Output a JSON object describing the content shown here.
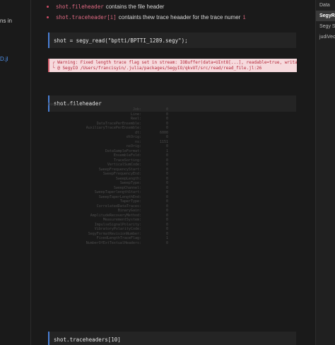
{
  "left_sidebar": {
    "fragment_1": "ns in",
    "fragment_2": "D.jl"
  },
  "bullets": [
    {
      "code": "shot.fileheader",
      "text": "contains the file header"
    },
    {
      "code": "shot.traceheader[i]",
      "text": "containts thew trace heaader for the trace numer",
      "trailing_code": "i"
    }
  ],
  "cells": {
    "read": "shot = segy_read(\"bptti/BPTTI_1289.segy\");",
    "fileheader": "shot.fileheader",
    "traceheaders": "shot.traceheaders[10]"
  },
  "warning": {
    "line1": "┌ Warning: Fixed length trace flag set in stream: IOBuffer(data=UInt8[...], readable=true, writa",
    "line2": "└ @ SegyIO /Users/francisyin/.julia/packages/SegyIO/qkvUT/src/read/read_file.jl:26"
  },
  "output": {
    "header": "BinaryFileHeader:",
    "rows": [
      {
        "k": "Job:",
        "v": "0"
      },
      {
        "k": "Line:",
        "v": "0"
      },
      {
        "k": "Reel:",
        "v": "0"
      },
      {
        "k": "DataTracePerEnsemble:",
        "v": "0"
      },
      {
        "k": "AuxiliaryTracePerEnsemble:",
        "v": "0"
      },
      {
        "k": "dt:",
        "v": "6000"
      },
      {
        "k": "dtOrig:",
        "v": "0"
      },
      {
        "k": "ns:",
        "v": "1151"
      },
      {
        "k": "nsOrig:",
        "v": "0"
      },
      {
        "k": "DataSampleFormat:",
        "v": "1"
      },
      {
        "k": "EnsembleFold:",
        "v": "0"
      },
      {
        "k": "TraceSorting:",
        "v": "0"
      },
      {
        "k": "VerticalSumCode:",
        "v": "0"
      },
      {
        "k": "SweepFrequencyStart:",
        "v": "0"
      },
      {
        "k": "SweepFrequencyEnd:",
        "v": "0"
      },
      {
        "k": "SweepLength:",
        "v": "0"
      },
      {
        "k": "SweepType:",
        "v": "0"
      },
      {
        "k": "SweepChannel:",
        "v": "0"
      },
      {
        "k": "SweepTaperlengthStart:",
        "v": "0"
      },
      {
        "k": "SweepTaperLengthEnd:",
        "v": "0"
      },
      {
        "k": "TaperType:",
        "v": "0"
      },
      {
        "k": "CorrelatedDataTraces:",
        "v": "0"
      },
      {
        "k": "BinaryGain:",
        "v": "0"
      },
      {
        "k": "AmplitudeRecoveryMethod:",
        "v": "0"
      },
      {
        "k": "MeasurementSystem:",
        "v": "0"
      },
      {
        "k": "ImpulseSignalPolarity:",
        "v": "0"
      },
      {
        "k": "VibratoryPolarityCode:",
        "v": "0"
      },
      {
        "k": "SegyFormatRevisionNumber:",
        "v": "0"
      },
      {
        "k": "FixedLengthTraceFlag:",
        "v": "1"
      },
      {
        "k": "NumberOfExtTextualHeaders:",
        "v": "0"
      }
    ]
  },
  "right_sidebar": {
    "items": [
      {
        "label": "Data",
        "active": false
      },
      {
        "label": "SegyRe",
        "active": true
      },
      {
        "label": "Segy S",
        "active": false
      },
      {
        "label": "judiVec",
        "active": false
      }
    ]
  }
}
